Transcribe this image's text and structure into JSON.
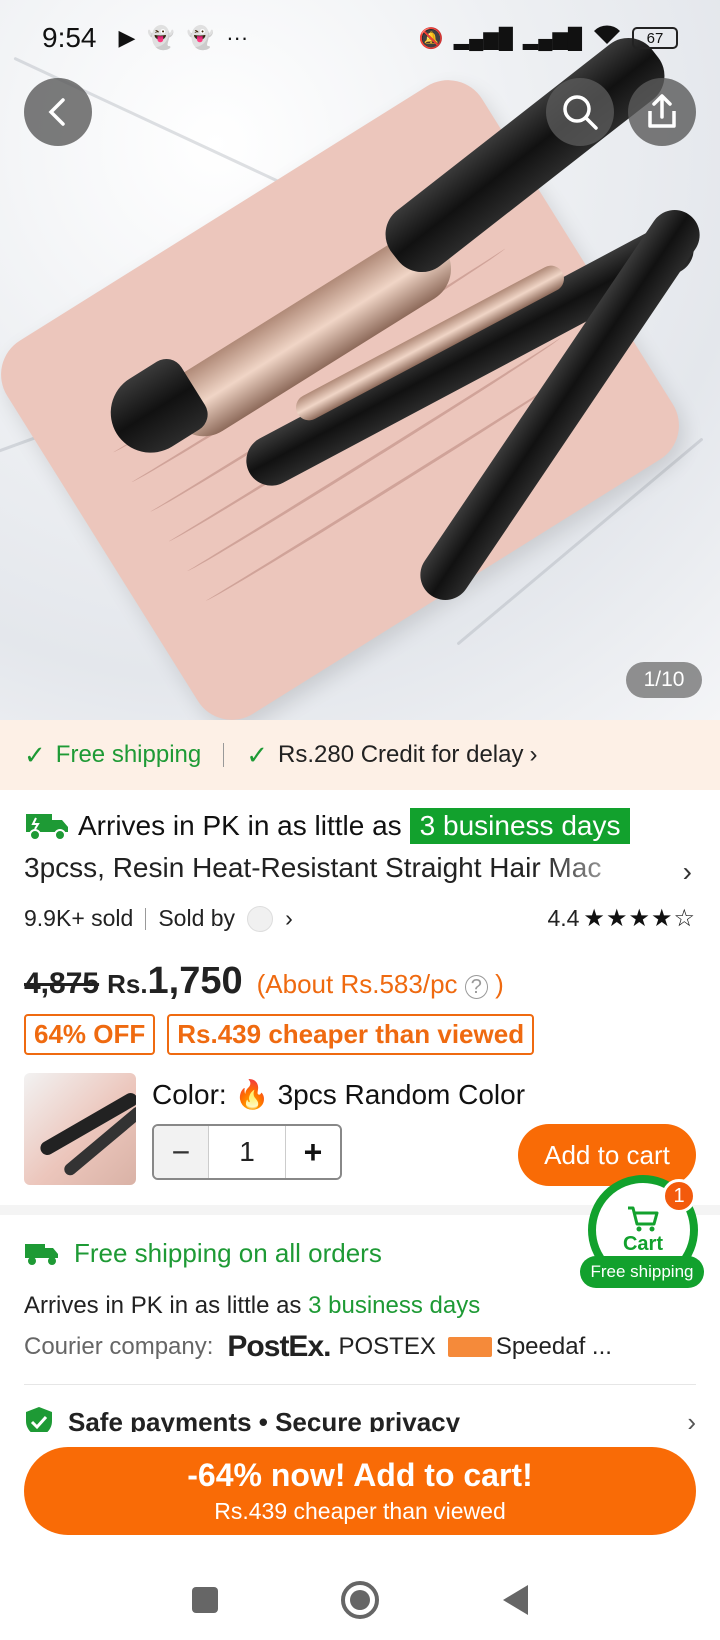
{
  "status_bar": {
    "time": "9:54",
    "battery": "67"
  },
  "hero": {
    "image_counter": "1/10"
  },
  "banner": {
    "free_shipping": "Free shipping",
    "credit": "Rs.280 Credit for delay"
  },
  "product": {
    "arrive_prefix": "Arrives in PK in as little as",
    "arrive_highlight": "3 business days",
    "title": "3pcss, Resin Heat-Resistant Straight Hair Mac",
    "sold": "9.9K+ sold",
    "sold_by": "Sold by",
    "rating": "4.4",
    "stars": "★★★★☆",
    "old_price": "4,875",
    "currency": "Rs.",
    "price": "1,750",
    "unit_price": "(About Rs.583/pc",
    "unit_price_close": ")",
    "tag_discount": "64% OFF",
    "tag_cheaper": "Rs.439 cheaper than viewed",
    "color_label": "Color:",
    "color_value": "3pcs Random Color",
    "quantity": "1",
    "add_to_cart": "Add to cart"
  },
  "float_cart": {
    "label": "Cart",
    "count": "1",
    "pill": "Free shipping"
  },
  "shipping": {
    "title": "Free shipping on all orders",
    "arrive_prefix": "Arrives in PK in as little as",
    "arrive_days": "3 business days",
    "courier_label": "Courier company:",
    "courier1_logo": "PostEx.",
    "courier1": "POSTEX",
    "courier2": "Speedaf ..."
  },
  "safe": {
    "label": "Safe payments • Secure privacy"
  },
  "cta": {
    "main": "-64% now! Add to cart!",
    "sub": "Rs.439 cheaper than viewed"
  },
  "colors": {
    "accent": "#f96b06",
    "green": "#12a12d",
    "banner_bg": "#fdf0e6"
  }
}
